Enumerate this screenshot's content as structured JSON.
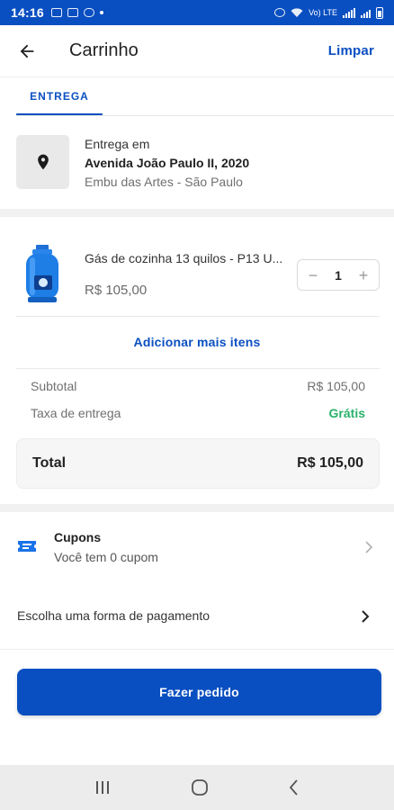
{
  "status_bar": {
    "time": "14:16",
    "network": "Vo) LTE"
  },
  "header": {
    "title": "Carrinho",
    "clear_label": "Limpar"
  },
  "tabs": [
    {
      "label": "ENTREGA",
      "active": true
    }
  ],
  "address": {
    "line1": "Entrega em",
    "line2": "Avenida João Paulo II, 2020",
    "line3": "Embu das Artes - São Paulo",
    "icon": "location-pin-icon"
  },
  "cart": {
    "items": [
      {
        "name": "Gás de cozinha 13 quilos - P13 U...",
        "price": "R$ 105,00",
        "quantity": "1",
        "minus": "−",
        "plus": "+"
      }
    ],
    "add_more_label": "Adicionar mais itens"
  },
  "summary": {
    "subtotal_label": "Subtotal",
    "subtotal_value": "R$ 105,00",
    "delivery_label": "Taxa de entrega",
    "delivery_value": "Grátis",
    "total_label": "Total",
    "total_value": "R$ 105,00"
  },
  "coupons": {
    "title": "Cupons",
    "subtitle": "Você tem 0 cupom"
  },
  "payment": {
    "label": "Escolha uma forma de pagamento"
  },
  "order_button": {
    "label": "Fazer pedido"
  },
  "colors": {
    "primary": "#0a4fc1",
    "success": "#27b26a",
    "band": "#f1f1f2"
  }
}
